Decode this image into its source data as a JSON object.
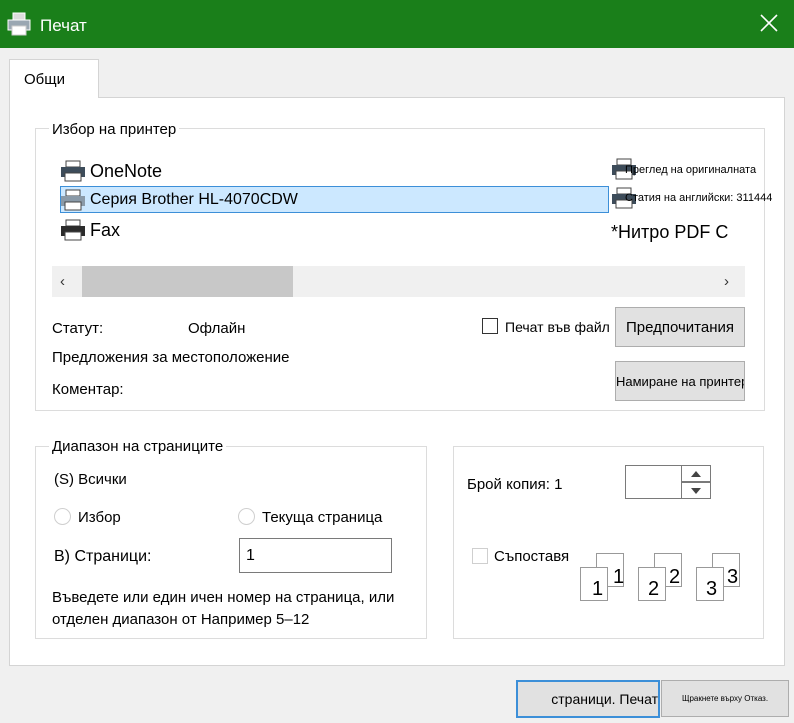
{
  "window": {
    "title": "Печат"
  },
  "tabs": [
    {
      "label": "Общи"
    }
  ],
  "printer_group": {
    "title": "Избор на принтер",
    "printers": [
      {
        "name": "OneNote",
        "icon": "printer-icon"
      },
      {
        "name": "Серия Brother HL-4070CDW",
        "icon": "printer-icon",
        "selected": true
      },
      {
        "name": "Fax",
        "icon": "printer-icon"
      }
    ],
    "right_printers": [
      {
        "name": "Преглед на оригиналната"
      },
      {
        "name": "Статия на английски: 311444"
      },
      {
        "name": "*Нитро PDF С"
      }
    ],
    "status_label": "Статут:",
    "status_value": "Офлайн",
    "location_label": "Предложения за местоположение",
    "comment_label": "Коментар:",
    "print_to_file_label": "Печат във файл",
    "preferences_button": "Предпочитания",
    "find_printer_button": "Намиране на принтер..."
  },
  "page_range": {
    "title": "Диапазон на страниците",
    "all_label": "(S) Всички",
    "selection_label": "Избор",
    "current_page_label": "Текуща страница",
    "pages_label": "В) Страници:",
    "pages_value": "1",
    "hint": "Въведете или един ичен номер на страница, или отделен диапазон от  Например 5–12"
  },
  "copies": {
    "count_label": "Брой копия: 1",
    "collate_label": "Съпоставя",
    "collate_pages": [
      "1",
      "2",
      "3"
    ]
  },
  "footer": {
    "print_button": "страници. Печат",
    "cancel_button": "Щракнете върху Отказ."
  },
  "colors": {
    "titlebar": "#1a7f1a",
    "selection": "#cce8ff",
    "selection_border": "#3c8fd8"
  }
}
